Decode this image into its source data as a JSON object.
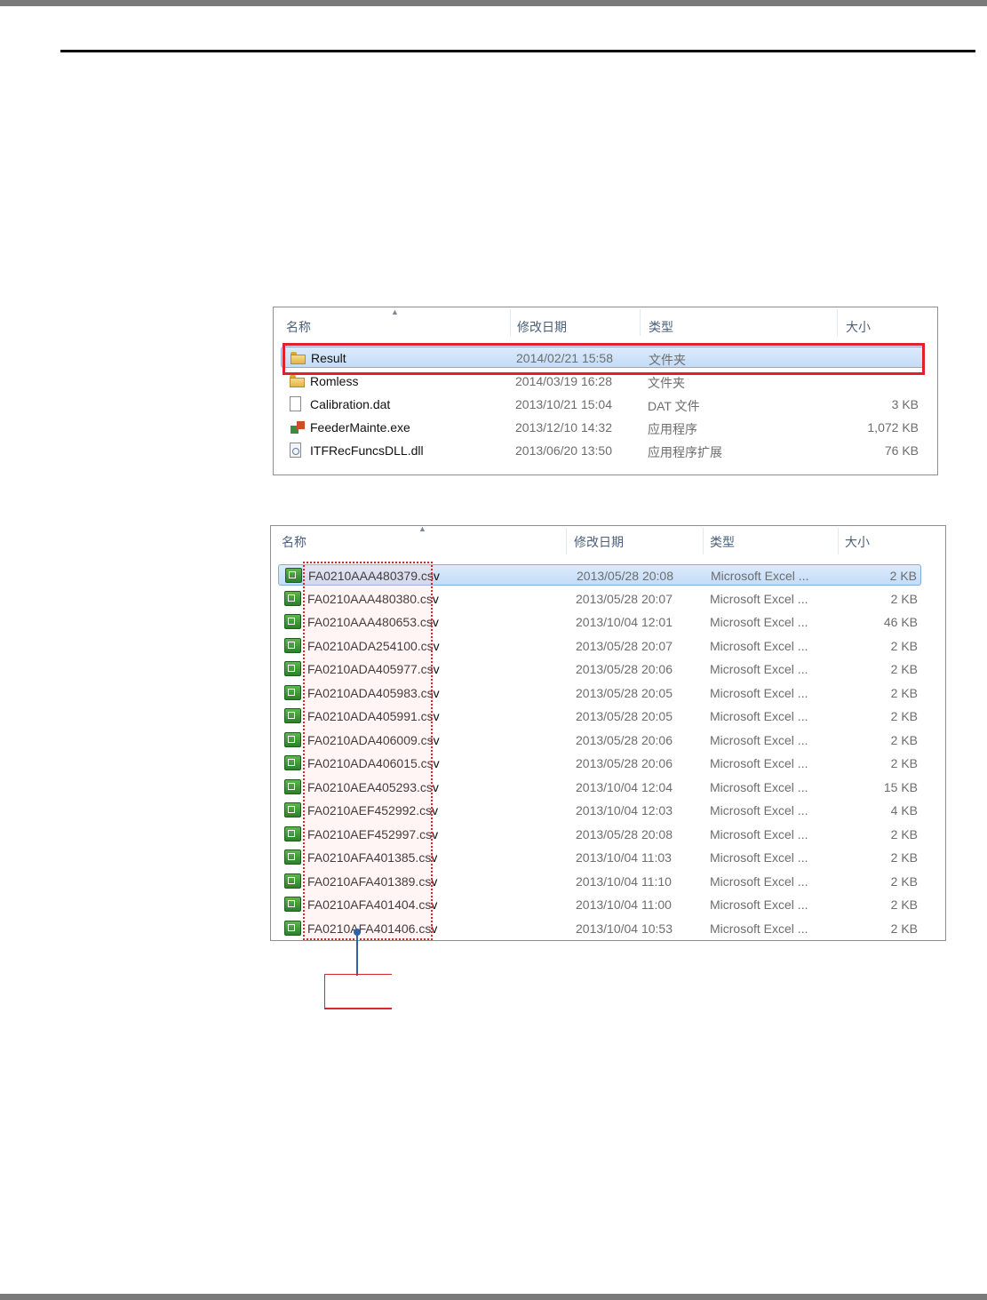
{
  "explorer1": {
    "columns": {
      "name": "名称",
      "date": "修改日期",
      "type": "类型",
      "size": "大小"
    },
    "rows": [
      {
        "name": "Result",
        "date": "2014/02/21 15:58",
        "type": "文件夹",
        "size": "",
        "icon": "folder-icon"
      },
      {
        "name": "Romless",
        "date": "2014/03/19 16:28",
        "type": "文件夹",
        "size": "",
        "icon": "folder-icon"
      },
      {
        "name": "Calibration.dat",
        "date": "2013/10/21 15:04",
        "type": "DAT 文件",
        "size": "3 KB",
        "icon": "file-icon"
      },
      {
        "name": "FeederMainte.exe",
        "date": "2013/12/10 14:32",
        "type": "应用程序",
        "size": "1,072 KB",
        "icon": "exe-icon"
      },
      {
        "name": "ITFRecFuncsDLL.dll",
        "date": "2013/06/20 13:50",
        "type": "应用程序扩展",
        "size": "76 KB",
        "icon": "dll-icon"
      }
    ]
  },
  "explorer2": {
    "columns": {
      "name": "名称",
      "date": "修改日期",
      "type": "类型",
      "size": "大小"
    },
    "rows": [
      {
        "name": "FA0210AAA480379.csv",
        "date": "2013/05/28 20:08",
        "type": "Microsoft Excel ...",
        "size": "2 KB"
      },
      {
        "name": "FA0210AAA480380.csv",
        "date": "2013/05/28 20:07",
        "type": "Microsoft Excel ...",
        "size": "2 KB"
      },
      {
        "name": "FA0210AAA480653.csv",
        "date": "2013/10/04 12:01",
        "type": "Microsoft Excel ...",
        "size": "46 KB"
      },
      {
        "name": "FA0210ADA254100.csv",
        "date": "2013/05/28 20:07",
        "type": "Microsoft Excel ...",
        "size": "2 KB"
      },
      {
        "name": "FA0210ADA405977.csv",
        "date": "2013/05/28 20:06",
        "type": "Microsoft Excel ...",
        "size": "2 KB"
      },
      {
        "name": "FA0210ADA405983.csv",
        "date": "2013/05/28 20:05",
        "type": "Microsoft Excel ...",
        "size": "2 KB"
      },
      {
        "name": "FA0210ADA405991.csv",
        "date": "2013/05/28 20:05",
        "type": "Microsoft Excel ...",
        "size": "2 KB"
      },
      {
        "name": "FA0210ADA406009.csv",
        "date": "2013/05/28 20:06",
        "type": "Microsoft Excel ...",
        "size": "2 KB"
      },
      {
        "name": "FA0210ADA406015.csv",
        "date": "2013/05/28 20:06",
        "type": "Microsoft Excel ...",
        "size": "2 KB"
      },
      {
        "name": "FA0210AEA405293.csv",
        "date": "2013/10/04 12:04",
        "type": "Microsoft Excel ...",
        "size": "15 KB"
      },
      {
        "name": "FA0210AEF452992.csv",
        "date": "2013/10/04 12:03",
        "type": "Microsoft Excel ...",
        "size": "4 KB"
      },
      {
        "name": "FA0210AEF452997.csv",
        "date": "2013/05/28 20:08",
        "type": "Microsoft Excel ...",
        "size": "2 KB"
      },
      {
        "name": "FA0210AFA401385.csv",
        "date": "2013/10/04 11:03",
        "type": "Microsoft Excel ...",
        "size": "2 KB"
      },
      {
        "name": "FA0210AFA401389.csv",
        "date": "2013/10/04 11:10",
        "type": "Microsoft Excel ...",
        "size": "2 KB"
      },
      {
        "name": "FA0210AFA401404.csv",
        "date": "2013/10/04 11:00",
        "type": "Microsoft Excel ...",
        "size": "2 KB"
      },
      {
        "name": "FA0210AFA401406.csv",
        "date": "2013/10/04 10:53",
        "type": "Microsoft Excel ...",
        "size": "2 KB"
      }
    ]
  },
  "colors": {
    "highlight_red": "#e2202a",
    "callout_blue": "#2f63a7",
    "selection_blue": "#c4dcf7"
  }
}
